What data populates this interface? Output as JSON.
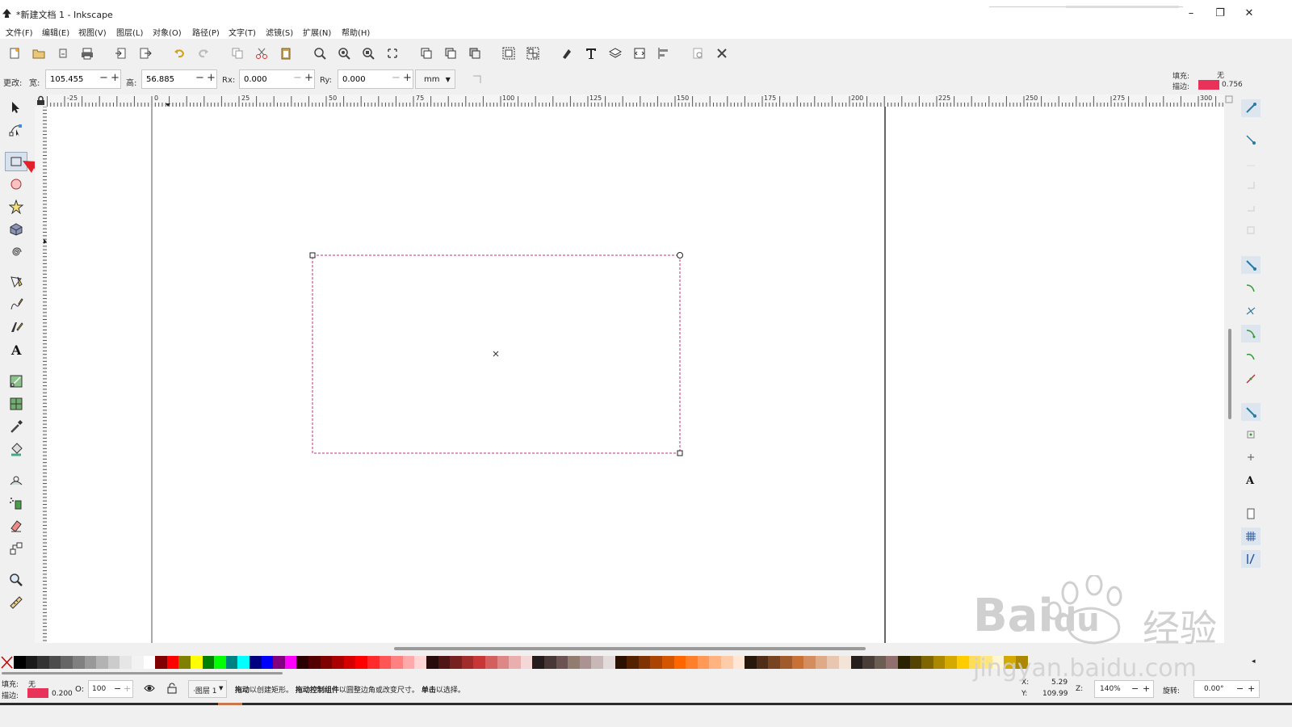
{
  "window": {
    "title": "*新建文档 1 - Inkscape",
    "minimize": "–",
    "restore": "❐",
    "close": "✕"
  },
  "menu": [
    "文件(F)",
    "编辑(E)",
    "视图(V)",
    "图层(L)",
    "对象(O)",
    "路径(P)",
    "文字(T)",
    "滤镜(S)",
    "扩展(N)",
    "帮助(H)"
  ],
  "controls": {
    "change_label": "更改:",
    "width_label": "宽:",
    "width_value": "105.455",
    "height_label": "高:",
    "height_value": "56.885",
    "rx_label": "Rx:",
    "rx_value": "0.000",
    "ry_label": "Ry:",
    "ry_value": "0.000",
    "unit": "mm"
  },
  "style_indicator": {
    "fill_label": "填充:",
    "fill_value": "无",
    "stroke_label": "描边:",
    "stroke_width": "0.756",
    "stroke_color": "#e8325a"
  },
  "ruler": {
    "h_ticks": [
      "-25",
      "0",
      "25",
      "50",
      "75",
      "100",
      "125",
      "150",
      "175",
      "200",
      "225",
      "250",
      "275",
      "300"
    ]
  },
  "statusbar": {
    "fill_label": "填充:",
    "fill_value": "无",
    "stroke_label": "描边:",
    "stroke_width": "0.200",
    "opacity_label": "O:",
    "opacity_value": "100",
    "layer": "·图层 1",
    "message_a": "拖动",
    "message_b": "以创建矩形。",
    "message_c": "拖动控制组件",
    "message_d": "以圆整边角或改变尺寸。",
    "message_e": "单击",
    "message_f": "以选择。",
    "x_label": "X:",
    "x_value": "5.29",
    "y_label": "Y:",
    "y_value": "109.99",
    "zoom_label": "Z:",
    "zoom_value": "140%",
    "rotate_label": "旋转:",
    "rotate_value": "0.00°"
  },
  "watermark": {
    "text_top": "Bai",
    "text_du": "du",
    "text_cn": "经验",
    "url": "jingyan.baidu.com"
  },
  "colors": {
    "accent": "#e8325a",
    "selection": "#c0307a",
    "arrow": "#e3212a"
  },
  "palette": [
    "#000000",
    "#1a1a1a",
    "#333333",
    "#4d4d4d",
    "#666666",
    "#808080",
    "#999999",
    "#b3b3b3",
    "#cccccc",
    "#e6e6e6",
    "#f2f2f2",
    "#ffffff",
    "#800000",
    "#ff0000",
    "#808000",
    "#ffff00",
    "#008000",
    "#00ff00",
    "#008080",
    "#00ffff",
    "#000080",
    "#0000ff",
    "#800080",
    "#ff00ff",
    "#2b0000",
    "#550000",
    "#800000",
    "#aa0000",
    "#d40000",
    "#ff0000",
    "#ff2a2a",
    "#ff5555",
    "#ff8080",
    "#ffaaaa",
    "#ffd5d5",
    "#280b0b",
    "#501616",
    "#782121",
    "#a02c2c",
    "#c83737",
    "#d35f5f",
    "#de8787",
    "#e9afaf",
    "#f4d7d7",
    "#241c1c",
    "#483737",
    "#6c5353",
    "#917c6f",
    "#ac9393",
    "#c8b7b7",
    "#e3dbdb",
    "#2b1100",
    "#552200",
    "#803300",
    "#aa4400",
    "#d45500",
    "#ff6600",
    "#ff7f2a",
    "#ff9955",
    "#ffb380",
    "#ffccaa",
    "#ffe6d5",
    "#28170b",
    "#502d16",
    "#784421",
    "#a05a2c",
    "#c87137",
    "#d38d5f",
    "#deaa87",
    "#e9c6af",
    "#f4e3d7",
    "#241f1c",
    "#483e37",
    "#6c5d53",
    "#916f6f",
    "#2b2200",
    "#554400",
    "#806600",
    "#aa8800",
    "#d4aa00",
    "#ffcc00",
    "#ffdd55",
    "#ffe680",
    "#fff6d5",
    "#d4aa00",
    "#aa8800"
  ]
}
